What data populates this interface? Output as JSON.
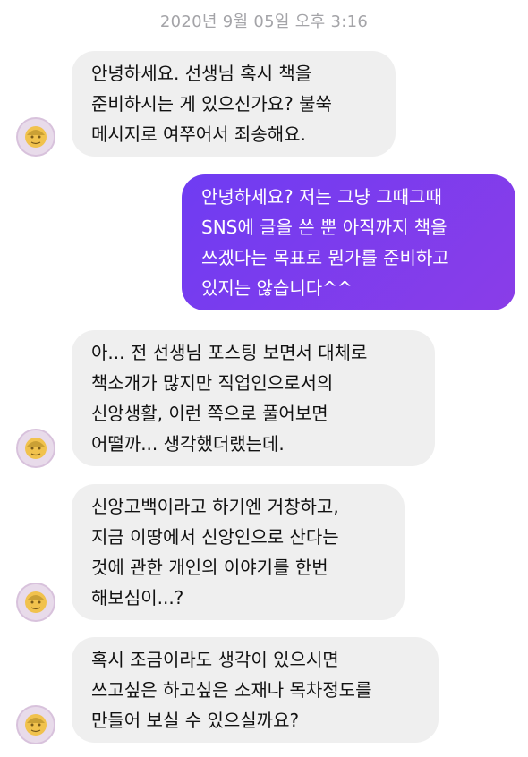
{
  "conversation": {
    "timestamp": "2020년 9월 05일 오후 3:16",
    "messages": [
      {
        "sender": "other",
        "text": "안녕하세요. 선생님 혹시 책을\n준비하시는 게 있으신가요? 불쑥\n메시지로 여쭈어서 죄송해요."
      },
      {
        "sender": "me",
        "text": "안녕하세요? 저는 그냥 그때그때\nSNS에 글을 쓴 뿐 아직까지 책을\n쓰겠다는 목표로 뭔가를 준비하고\n있지는 않습니다^^"
      },
      {
        "sender": "other",
        "text": "아... 전 선생님 포스팅 보면서 대체로\n책소개가 많지만 직업인으로서의\n신앙생활, 이런 쪽으로 풀어보면\n어떨까... 생각했더랬는데."
      },
      {
        "sender": "other",
        "text": "신앙고백이라고 하기엔 거창하고,\n지금 이땅에서 신앙인으로 산다는\n것에 관한 개인의 이야기를 한번\n해보심이...?"
      },
      {
        "sender": "other",
        "text": "혹시 조금이라도 생각이 있으시면\n쓰고싶은 하고싶은 소재나 목차정도를\n만들어 보실 수 있으실까요?"
      }
    ]
  },
  "colors": {
    "incoming_bubble": "#efefef",
    "outgoing_bubble": "#7c3df0",
    "timestamp": "#a4a4a8"
  },
  "icons": {
    "avatar": "avatar-icon"
  }
}
